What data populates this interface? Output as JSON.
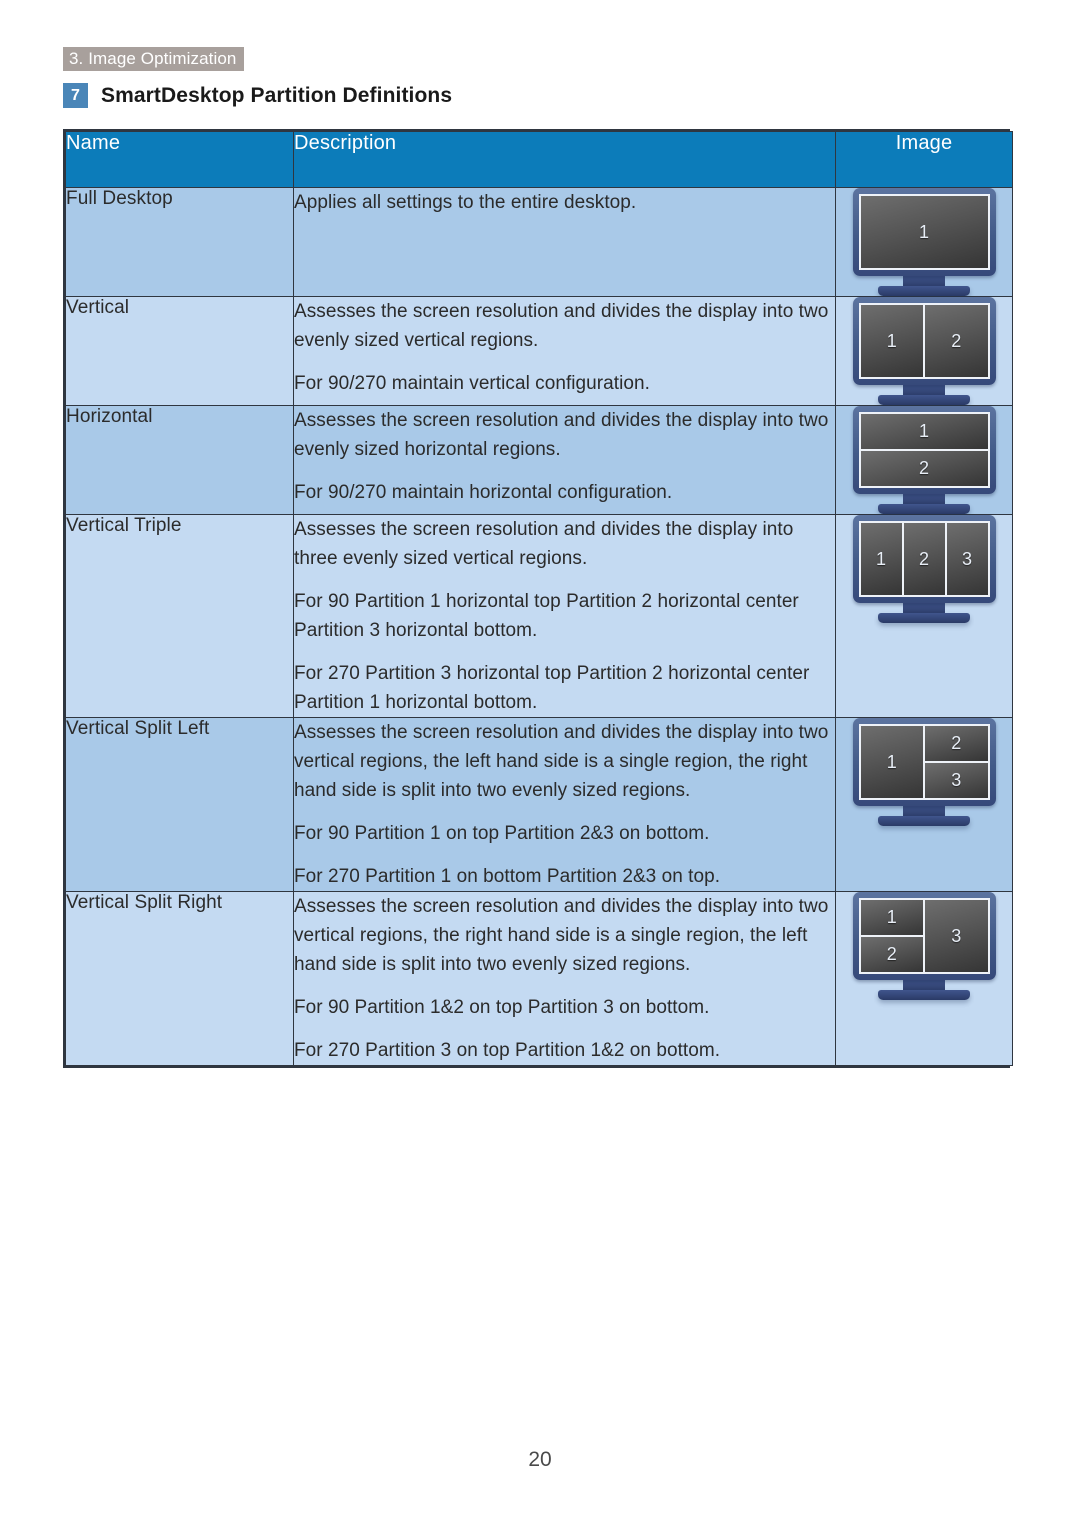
{
  "running_head": "3. Image Optimization",
  "section": {
    "badge": "7",
    "title": "SmartDesktop Partition Definitions"
  },
  "table": {
    "headers": {
      "name": "Name",
      "description": "Description",
      "image": "Image"
    },
    "rows": [
      {
        "name": "Full Desktop",
        "description": [
          "Applies all settings to the entire desktop."
        ],
        "image_layout": "full",
        "image_labels": [
          "1"
        ]
      },
      {
        "name": "Vertical",
        "description": [
          "Assesses the screen resolution and divides the display into two evenly sized vertical regions.",
          "For 90/270 maintain vertical configuration."
        ],
        "image_layout": "vertical-2",
        "image_labels": [
          "1",
          "2"
        ]
      },
      {
        "name": "Horizontal",
        "description": [
          "Assesses the screen resolution and divides the display into two evenly sized horizontal regions.",
          "For 90/270 maintain horizontal configuration."
        ],
        "image_layout": "horizontal-2",
        "image_labels": [
          "1",
          "2"
        ]
      },
      {
        "name": "Vertical Triple",
        "description": [
          "Assesses the screen resolution and divides the display into three evenly sized vertical regions.",
          "For 90 Partition 1 horizontal top Partition 2 horizontal center Partition 3 horizontal bottom.",
          "For 270 Partition 3 horizontal top Partition 2 horizontal center Partition 1 horizontal bottom."
        ],
        "image_layout": "vertical-3",
        "image_labels": [
          "1",
          "2",
          "3"
        ]
      },
      {
        "name": "Vertical Split Left",
        "description": [
          "Assesses the screen resolution and divides the display into two vertical regions, the left hand side is a single region, the right hand side is split into two evenly sized regions.",
          "For 90 Partition 1 on top Partition 2&3 on bottom.",
          "For 270 Partition 1 on bottom Partition 2&3 on top."
        ],
        "image_layout": "split-left",
        "image_labels": [
          "1",
          "2",
          "3"
        ]
      },
      {
        "name": "Vertical Split Right",
        "description": [
          "Assesses the screen resolution and divides the display into two vertical regions, the right  hand side is a single region, the left  hand side is split into two evenly sized regions.",
          "For 90 Partition 1&2  on top Partition 3 on bottom.",
          "For 270 Partition 3 on top Partition 1&2 on bottom."
        ],
        "image_layout": "split-right",
        "image_labels": [
          "1",
          "2",
          "3"
        ]
      }
    ]
  },
  "page_number": "20",
  "colors": {
    "header_band": "#a8a09c",
    "badge": "#4a86b8",
    "table_header": "#0c7cba",
    "row_shade_a": "#a9c9e8",
    "row_shade_b": "#c4daf2",
    "border": "#2f3640",
    "monitor_bezel": "#42588a"
  }
}
